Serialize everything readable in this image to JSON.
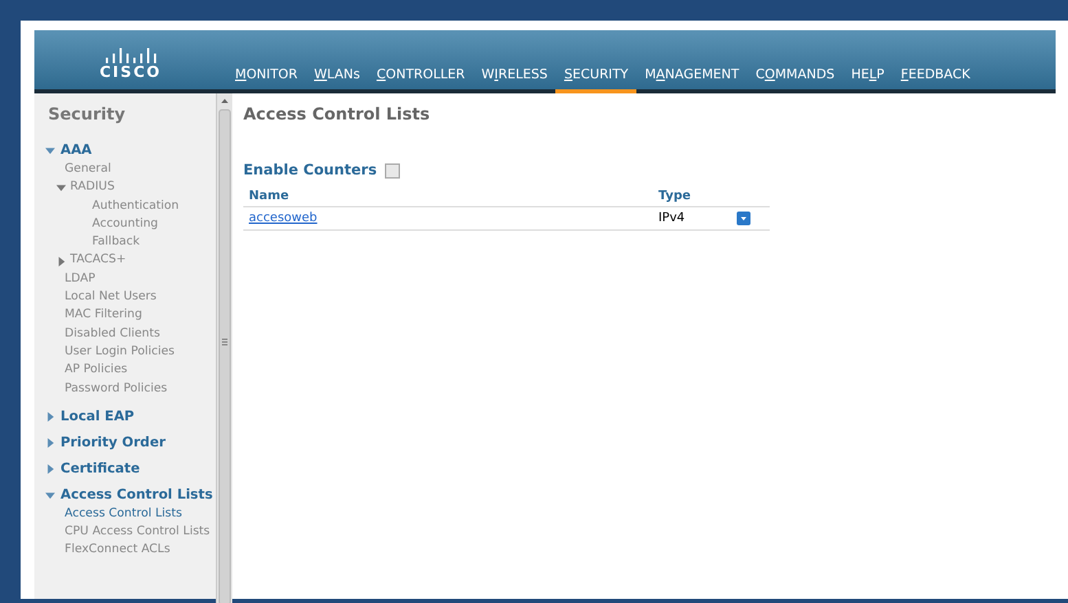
{
  "header": {
    "logo": "CISCO",
    "menu": [
      {
        "key": "M",
        "after": "ONITOR",
        "selected": false
      },
      {
        "key": "W",
        "after": "LANs",
        "selected": false
      },
      {
        "key": "C",
        "after": "ONTROLLER",
        "selected": false
      },
      {
        "before": "W",
        "key": "I",
        "after": "RELESS",
        "selected": false
      },
      {
        "key": "S",
        "after": "ECURITY",
        "selected": true
      },
      {
        "before": "M",
        "key": "A",
        "after": "NAGEMENT",
        "selected": false
      },
      {
        "before": "C",
        "key": "O",
        "after": "MMANDS",
        "selected": false
      },
      {
        "before": "HE",
        "key": "L",
        "after": "P",
        "selected": false
      },
      {
        "key": "F",
        "after": "EEDBACK",
        "selected": false
      }
    ]
  },
  "sidebar": {
    "title": "Security",
    "sections": [
      {
        "label": "AAA",
        "expanded": true,
        "children": [
          {
            "label": "General",
            "selected": false
          },
          {
            "label": "RADIUS",
            "expanded": true,
            "selected": false,
            "children": [
              {
                "label": "Authentication",
                "selected": false
              },
              {
                "label": "Accounting",
                "selected": false
              },
              {
                "label": "Fallback",
                "selected": false
              }
            ]
          },
          {
            "label": "TACACS+",
            "expanded": false,
            "selected": false
          },
          {
            "label": "LDAP",
            "selected": false
          },
          {
            "label": "Local Net Users",
            "selected": false
          },
          {
            "label": "MAC Filtering",
            "selected": false
          },
          {
            "label": "Disabled Clients",
            "selected": false
          },
          {
            "label": "User Login Policies",
            "selected": false
          },
          {
            "label": "AP Policies",
            "selected": false
          },
          {
            "label": "Password Policies",
            "selected": false
          }
        ]
      },
      {
        "label": "Local EAP",
        "expanded": false
      },
      {
        "label": "Priority Order",
        "expanded": false
      },
      {
        "label": "Certificate",
        "expanded": false
      },
      {
        "label": "Access Control Lists",
        "expanded": true,
        "children": [
          {
            "label": "Access Control Lists",
            "selected": true
          },
          {
            "label": "CPU Access Control Lists",
            "selected": false
          },
          {
            "label": "FlexConnect ACLs",
            "selected": false
          }
        ]
      }
    ]
  },
  "content": {
    "title": "Access Control Lists",
    "enable_counters": {
      "label": "Enable Counters",
      "checked": false
    },
    "table": {
      "columns": [
        "Name",
        "Type"
      ],
      "rows": [
        {
          "name": "accesoweb",
          "type": "IPv4"
        }
      ]
    }
  }
}
